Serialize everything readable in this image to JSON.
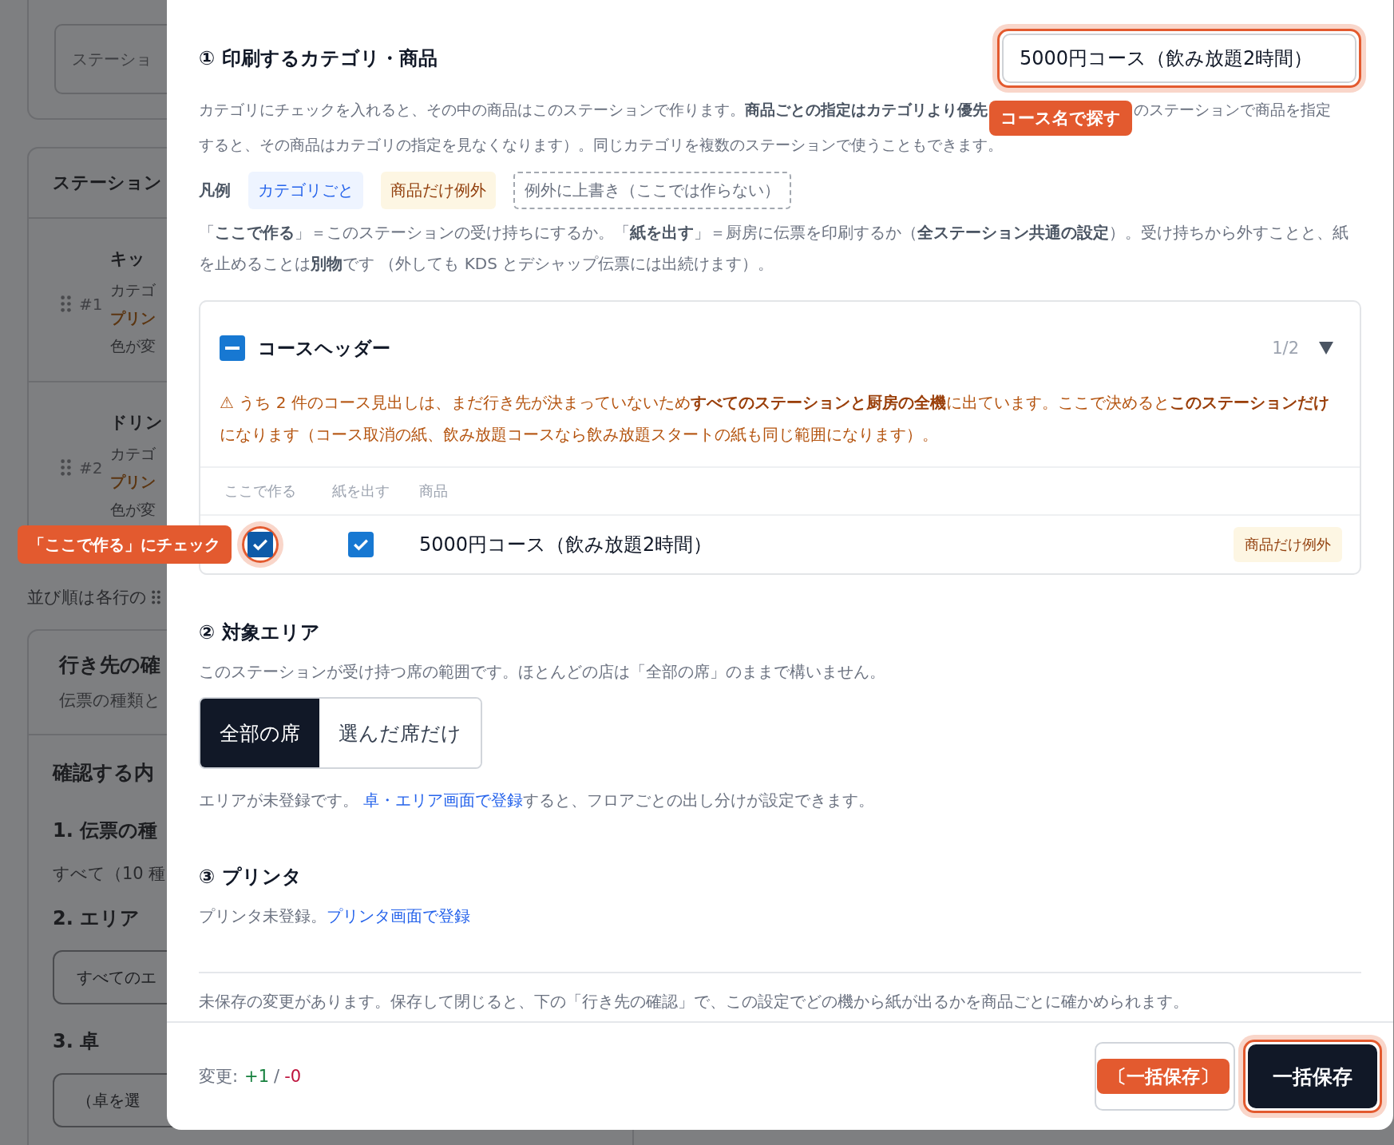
{
  "background": {
    "search_placeholder": "ステーショ",
    "list_title": "ステーション",
    "stations": [
      {
        "number": "#1",
        "name": "キッ",
        "lines": [
          {
            "text": "カテゴ",
            "kind": "detail"
          },
          {
            "text": "プリン",
            "kind": "printer"
          },
          {
            "text": "色が変",
            "kind": "detail"
          }
        ]
      },
      {
        "number": "#2",
        "name": "ドリン",
        "lines": [
          {
            "text": "カテゴ",
            "kind": "detail"
          },
          {
            "text": "プリン",
            "kind": "printer"
          },
          {
            "text": "色が変",
            "kind": "detail"
          }
        ]
      }
    ],
    "sort_hint": "並び順は各行の",
    "check_card": {
      "title": "行き先の確",
      "subtitle": "伝票の種類と",
      "section": "確認する内",
      "steps": [
        {
          "kind": "text",
          "label": "1. 伝票の種",
          "value": "すべて（10 種"
        },
        {
          "kind": "field",
          "label": "2. エリア",
          "value": "すべてのエ"
        },
        {
          "kind": "field",
          "label": "3. 卓",
          "value": "（卓を選"
        }
      ]
    }
  },
  "modal": {
    "section1": {
      "title": "① 印刷するカテゴリ・商品",
      "search": {
        "value": "5000円コース（飲み放題2時間）",
        "highlighted": true,
        "callout": "コース名で探す"
      },
      "description_before": "カテゴリにチェックを入れると、その中の商品はこのステーションで作ります。**商品ごとの指定はカテゴリより優先**",
      "description_after": "のステーションで商品を指定",
      "description_line2": "すると、その商品はカテゴリの指定を見なくなります）。同じカテゴリを複数のステーションで使うこともできます。",
      "legend_label": "凡例",
      "legend": [
        {
          "kind": "category",
          "text": "カテゴリごと"
        },
        {
          "kind": "exception",
          "text": "商品だけ例外"
        },
        {
          "kind": "override",
          "text": "例外に上書き（ここでは作らない）"
        }
      ],
      "note": "「**ここで作る**」＝このステーションの受け持ちにするか。「**紙を出す**」＝厨房に伝票を印刷するか（**全ステーション共通の設定**）。受け持ちから外すことと、紙を止めることは**別物**です （外しても KDS とデシャップ伝票には出続けます）。",
      "category": {
        "name": "コースヘッダー",
        "indeterminate": true,
        "count": "1/2",
        "expanded": true,
        "warning": "⚠ うち 2 件のコース見出しは、まだ行き先が決まっていないため**すべてのステーションと厨房の全機**に出ています。ここで決めると**このステーションだけ**になります（コース取消の紙、飲み放題コースなら飲み放題スタートの紙も同じ範囲になります）。",
        "columns": [
          "ここで作る",
          "紙を出す",
          "商品"
        ],
        "items": [
          {
            "make": true,
            "make_highlighted": true,
            "make_callout": "「ここで作る」にチェック",
            "print": true,
            "name": "5000円コース（飲み放題2時間）",
            "tag": {
              "kind": "exception",
              "text": "商品だけ例外"
            }
          }
        ]
      }
    },
    "section2": {
      "title": "② 対象エリア",
      "description": "このステーションが受け持つ席の範囲です。ほとんどの店は「全部の席」のままで構いません。",
      "options": [
        {
          "label": "全部の席",
          "selected": true
        },
        {
          "label": "選んだ席だけ",
          "selected": false
        }
      ],
      "note_before": "エリアが未登録です。",
      "note_link": "卓・エリア画面で登録",
      "note_after": "すると、フロアごとの出し分けが設定できます。"
    },
    "section3": {
      "title": "③ プリンタ",
      "note_before": "プリンタ未登録。",
      "note_link": "プリンタ画面で登録"
    },
    "unsaved": "未保存の変更があります。保存して閉じると、下の「行き先の確認」で、この設定でどの機から紙が出るかを商品ごとに確かめられます。",
    "footer": {
      "changes_label": "変更:",
      "added": "+1",
      "separator": "/",
      "removed": "-0",
      "secondary": {
        "callout": "〔一括保存〕"
      },
      "primary": {
        "label": "一括保存",
        "highlighted": true
      }
    }
  }
}
